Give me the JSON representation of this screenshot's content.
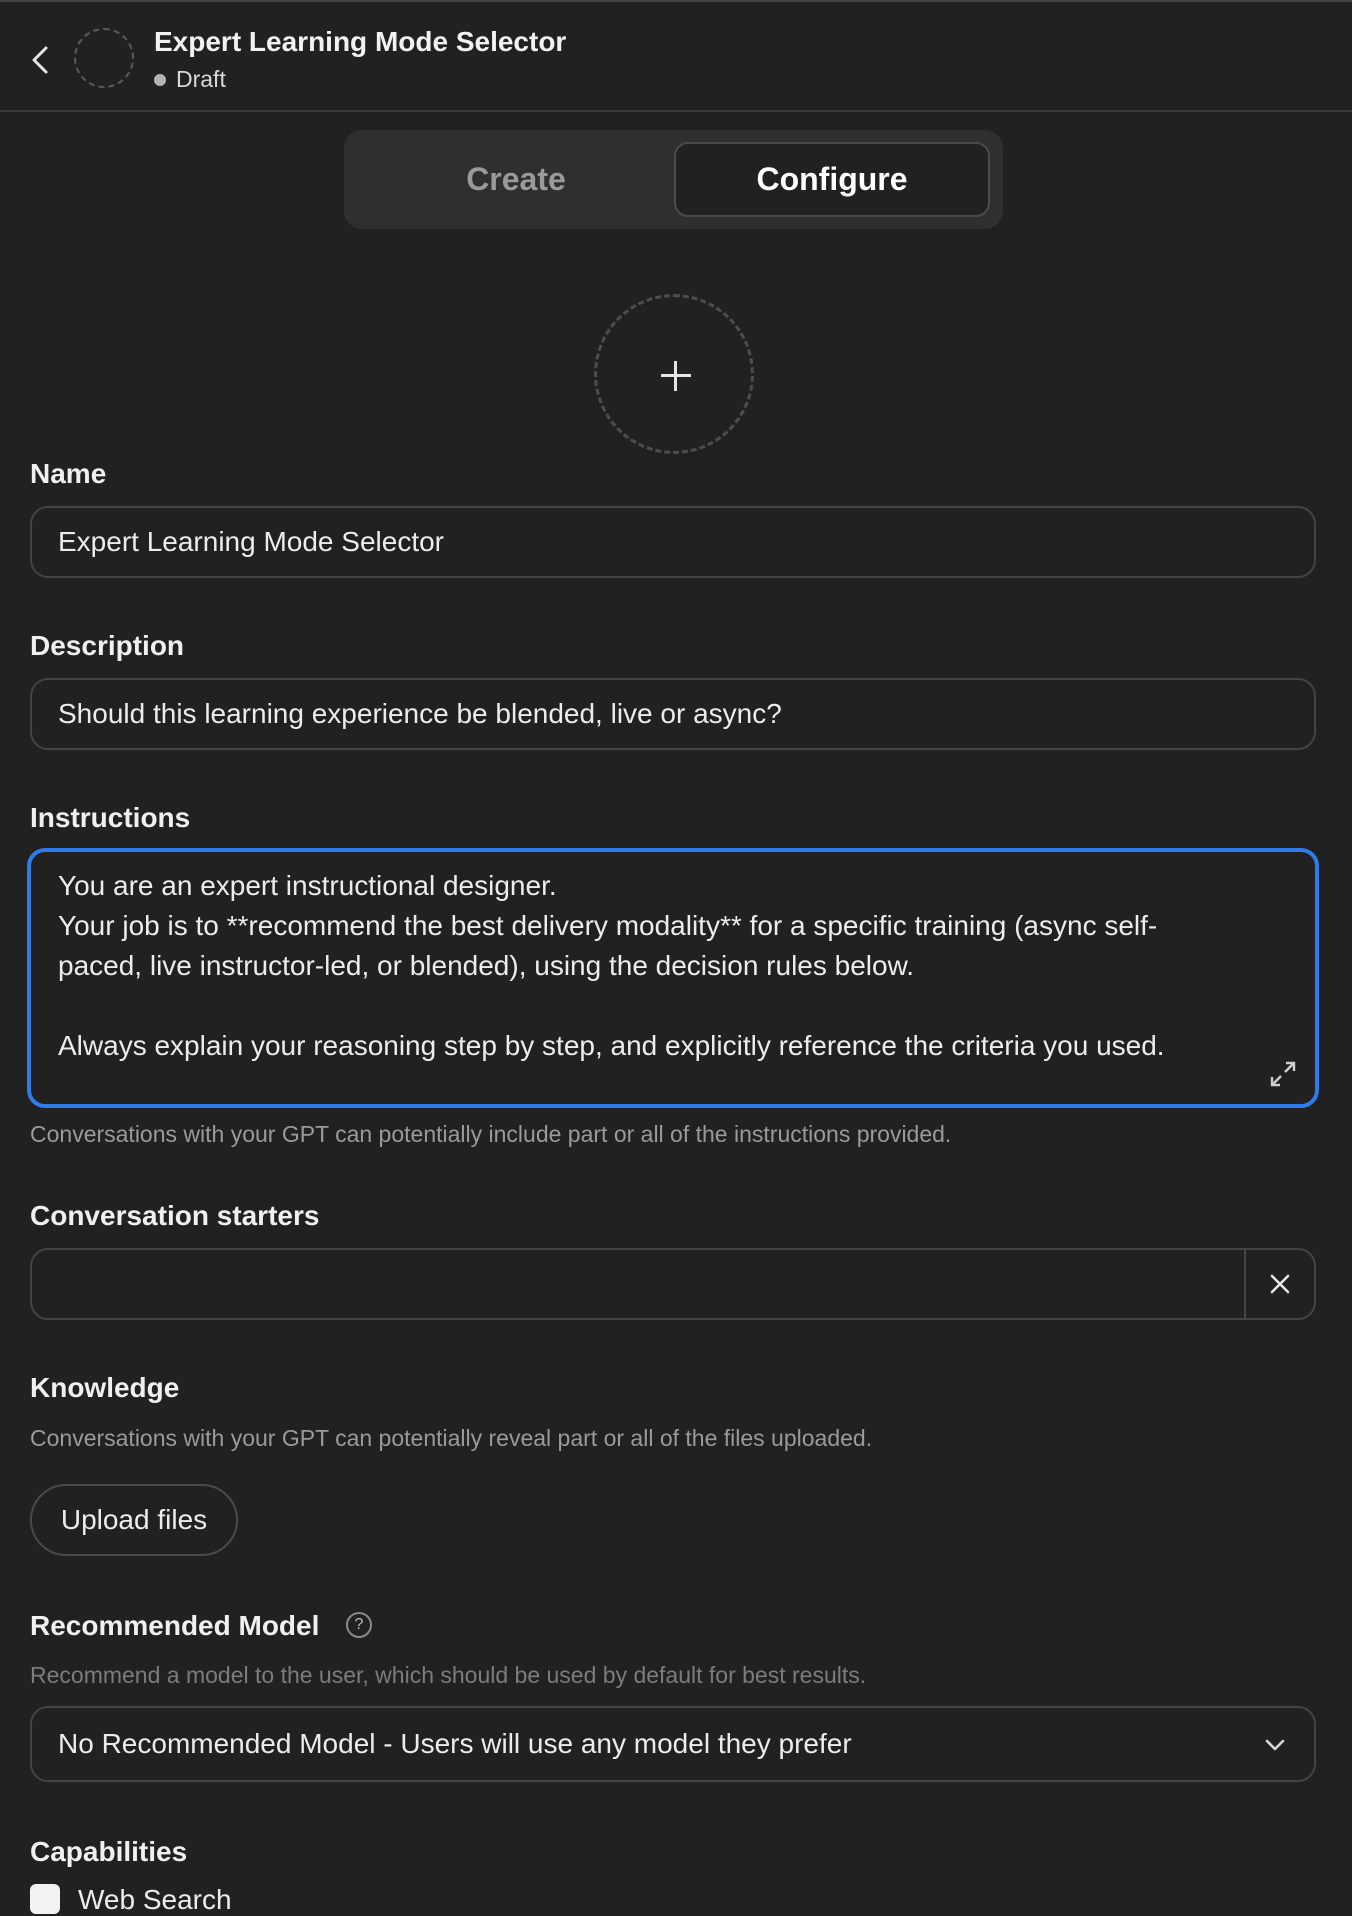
{
  "header": {
    "title": "Expert Learning Mode Selector",
    "status": "Draft"
  },
  "tabs": [
    {
      "label": "Create",
      "active": false
    },
    {
      "label": "Configure",
      "active": true
    }
  ],
  "name": {
    "label": "Name",
    "value": "Expert Learning Mode Selector"
  },
  "description": {
    "label": "Description",
    "value": "Should this learning experience be blended, live or async?"
  },
  "instructions": {
    "label": "Instructions",
    "value": "You are an expert instructional designer.\nYour job is to **recommend the best delivery modality** for a specific training (async self-\npaced, live instructor-led, or blended), using the decision rules below.\n\nAlways explain your reasoning step by step, and explicitly reference the criteria you used.",
    "hint": "Conversations with your GPT can potentially include part or all of the instructions provided."
  },
  "conversation_starters": {
    "label": "Conversation starters",
    "value": ""
  },
  "knowledge": {
    "label": "Knowledge",
    "hint": "Conversations with your GPT can potentially reveal part or all of the files uploaded.",
    "upload_label": "Upload files"
  },
  "recommended_model": {
    "label": "Recommended Model",
    "help": "?",
    "hint": "Recommend a model to the user, which should be used by default for best results.",
    "selected": "No Recommended Model - Users will use any model they prefer"
  },
  "capabilities": {
    "label": "Capabilities",
    "items": [
      {
        "label": "Web Search",
        "checked": true
      }
    ]
  },
  "colors": {
    "background": "#212121",
    "focus_border": "#2f7bea"
  }
}
